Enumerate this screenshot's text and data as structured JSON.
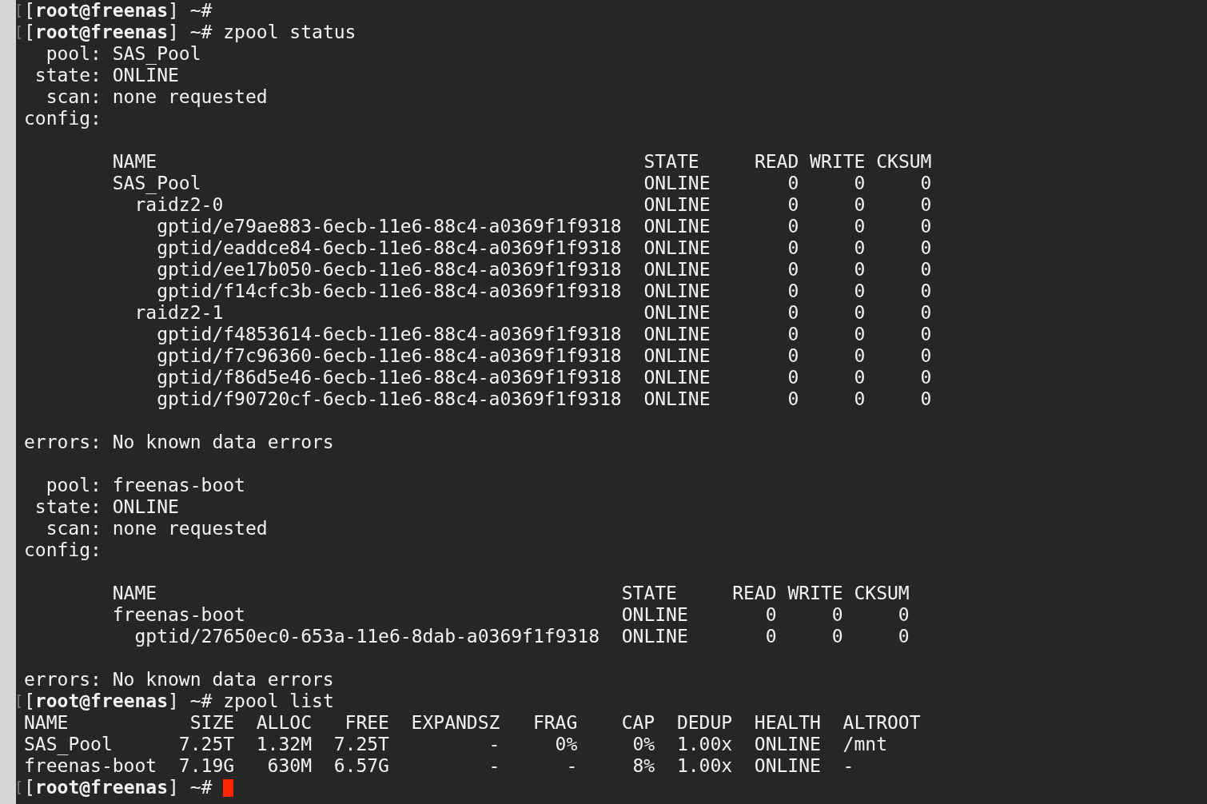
{
  "terminal": {
    "blocks": [
      {
        "kind": "prompt",
        "text": "[**root@freenas**] ~#"
      },
      {
        "kind": "prompt",
        "text": "[**root@freenas**] ~# zpool status"
      },
      {
        "kind": "field",
        "label": "pool:",
        "value": "SAS_Pool"
      },
      {
        "kind": "field",
        "label": "state:",
        "value": "ONLINE"
      },
      {
        "kind": "field",
        "label": "scan:",
        "value": "none requested"
      },
      {
        "kind": "field",
        "label": "config:"
      },
      {
        "kind": "blank"
      },
      {
        "kind": "vdev_table",
        "columns": [
          {
            "label": "NAME",
            "kind": "name"
          },
          {
            "label": "STATE",
            "kind": "state"
          },
          {
            "label": "READ",
            "kind": "number"
          },
          {
            "label": "WRITE",
            "kind": "number"
          },
          {
            "label": "CKSUM",
            "kind": "number"
          }
        ],
        "rows": [
          {
            "cells": [
              "SAS_Pool",
              "ONLINE",
              "0",
              "0",
              "0"
            ],
            "children": [
              {
                "cells": [
                  "raidz2-0",
                  "ONLINE",
                  "0",
                  "0",
                  "0"
                ],
                "children": [
                  {
                    "cells": [
                      "gptid/e79ae883-6ecb-11e6-88c4-a0369f1f9318",
                      "ONLINE",
                      "0",
                      "0",
                      "0"
                    ]
                  },
                  {
                    "cells": [
                      "gptid/eaddce84-6ecb-11e6-88c4-a0369f1f9318",
                      "ONLINE",
                      "0",
                      "0",
                      "0"
                    ]
                  },
                  {
                    "cells": [
                      "gptid/ee17b050-6ecb-11e6-88c4-a0369f1f9318",
                      "ONLINE",
                      "0",
                      "0",
                      "0"
                    ]
                  },
                  {
                    "cells": [
                      "gptid/f14cfc3b-6ecb-11e6-88c4-a0369f1f9318",
                      "ONLINE",
                      "0",
                      "0",
                      "0"
                    ]
                  }
                ]
              },
              {
                "cells": [
                  "raidz2-1",
                  "ONLINE",
                  "0",
                  "0",
                  "0"
                ],
                "children": [
                  {
                    "cells": [
                      "gptid/f4853614-6ecb-11e6-88c4-a0369f1f9318",
                      "ONLINE",
                      "0",
                      "0",
                      "0"
                    ]
                  },
                  {
                    "cells": [
                      "gptid/f7c96360-6ecb-11e6-88c4-a0369f1f9318",
                      "ONLINE",
                      "0",
                      "0",
                      "0"
                    ]
                  },
                  {
                    "cells": [
                      "gptid/f86d5e46-6ecb-11e6-88c4-a0369f1f9318",
                      "ONLINE",
                      "0",
                      "0",
                      "0"
                    ]
                  },
                  {
                    "cells": [
                      "gptid/f90720cf-6ecb-11e6-88c4-a0369f1f9318",
                      "ONLINE",
                      "0",
                      "0",
                      "0"
                    ]
                  }
                ]
              }
            ]
          }
        ]
      },
      {
        "kind": "blank"
      },
      {
        "kind": "field",
        "label": "errors:",
        "value": "No known data errors"
      },
      {
        "kind": "blank"
      },
      {
        "kind": "field",
        "label": "pool:",
        "value": "freenas-boot"
      },
      {
        "kind": "field",
        "label": "state:",
        "value": "ONLINE"
      },
      {
        "kind": "field",
        "label": "scan:",
        "value": "none requested"
      },
      {
        "kind": "field",
        "label": "config:"
      },
      {
        "kind": "blank"
      },
      {
        "kind": "vdev_table",
        "columns": [
          {
            "label": "NAME",
            "kind": "name"
          },
          {
            "label": "STATE",
            "kind": "state"
          },
          {
            "label": "READ",
            "kind": "number"
          },
          {
            "label": "WRITE",
            "kind": "number"
          },
          {
            "label": "CKSUM",
            "kind": "number"
          }
        ],
        "rows": [
          {
            "cells": [
              "freenas-boot",
              "ONLINE",
              "0",
              "0",
              "0"
            ],
            "children": [
              {
                "cells": [
                  "gptid/27650ec0-653a-11e6-8dab-a0369f1f9318",
                  "ONLINE",
                  "0",
                  "0",
                  "0"
                ]
              }
            ]
          }
        ]
      },
      {
        "kind": "blank"
      },
      {
        "kind": "field",
        "label": "errors:",
        "value": "No known data errors"
      },
      {
        "kind": "prompt",
        "text": "[**root@freenas**] ~# zpool list"
      },
      {
        "kind": "list_table",
        "columns": [
          {
            "label": "NAME",
            "kind": "text"
          },
          {
            "label": "SIZE",
            "kind": "number"
          },
          {
            "label": "ALLOC",
            "kind": "number"
          },
          {
            "label": "FREE",
            "kind": "number"
          },
          {
            "label": "EXPANDSZ",
            "kind": "number"
          },
          {
            "label": "FRAG",
            "kind": "number"
          },
          {
            "label": "CAP",
            "kind": "number"
          },
          {
            "label": "DEDUP",
            "kind": "number"
          },
          {
            "label": "HEALTH",
            "kind": "text"
          },
          {
            "label": "ALTROOT",
            "kind": "text"
          }
        ],
        "rows": [
          [
            "SAS_Pool",
            "7.25T",
            "1.32M",
            "7.25T",
            "-",
            "0%",
            "0%",
            "1.00x",
            "ONLINE",
            "/mnt"
          ],
          [
            "freenas-boot",
            "7.19G",
            "630M",
            "6.57G",
            "-",
            "-",
            "8%",
            "1.00x",
            "ONLINE",
            "-"
          ]
        ]
      },
      {
        "kind": "prompt",
        "text": "[**root@freenas**] ~#",
        "cursor": true
      }
    ]
  }
}
